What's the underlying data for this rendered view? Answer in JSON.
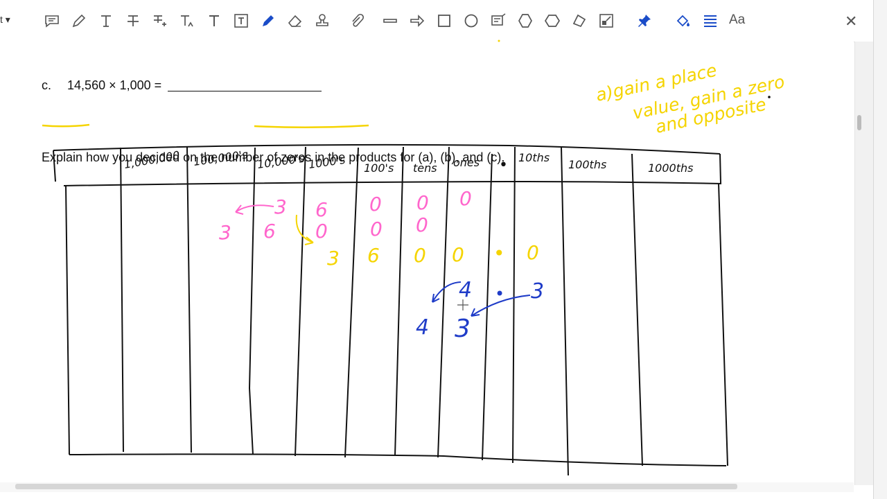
{
  "toolbar": {
    "left_label": "t ▾",
    "tools": [
      "comment-icon",
      "pencil-icon",
      "text-icon",
      "strikethrough-icon",
      "replace-text-icon",
      "text-insert-icon",
      "text-plain-icon",
      "textbox-icon",
      "pen-icon",
      "eraser-icon",
      "stamp-icon",
      "attach-icon",
      "line-icon",
      "arrow-icon",
      "rectangle-icon",
      "oval-icon",
      "callout-icon",
      "polygon-icon",
      "cloud-icon",
      "polyline-icon",
      "snapshot-icon",
      "pin-icon",
      "fill-color-icon",
      "line-weight-icon"
    ],
    "font_label": "Aa",
    "close_label": "✕"
  },
  "document": {
    "question_c_label": "c.",
    "question_c_expr": "14,560 × 1,000 =",
    "explain_words": [
      "Explain",
      " how you decided on the ",
      "number of zeros",
      " in the products for (a), (b), and (c)."
    ],
    "note_lines": [
      "a)gain a place",
      "value, gain a zero",
      "and opposite"
    ],
    "columns": [
      "1,000,000",
      "100,000's",
      "10,000's",
      "1000's",
      "100's",
      "tens",
      "ones",
      "•",
      "10ths",
      "100ths",
      "1000ths"
    ],
    "pink_row1": [
      "3",
      "6",
      "0",
      "0",
      "0"
    ],
    "pink_row2": [
      "3",
      "6",
      "0",
      "0",
      "0"
    ],
    "yellow_row": [
      "3",
      "6",
      "0",
      "0",
      "•",
      "0"
    ],
    "blue_top": [
      "4",
      "•",
      "3"
    ],
    "blue_bottom": [
      "4",
      "3"
    ]
  },
  "colors": {
    "pink": "#ff66cc",
    "yellow": "#f5d400",
    "blue": "#1f3cc8",
    "ink": "#111111",
    "tool_blue": "#1a4cc8"
  }
}
